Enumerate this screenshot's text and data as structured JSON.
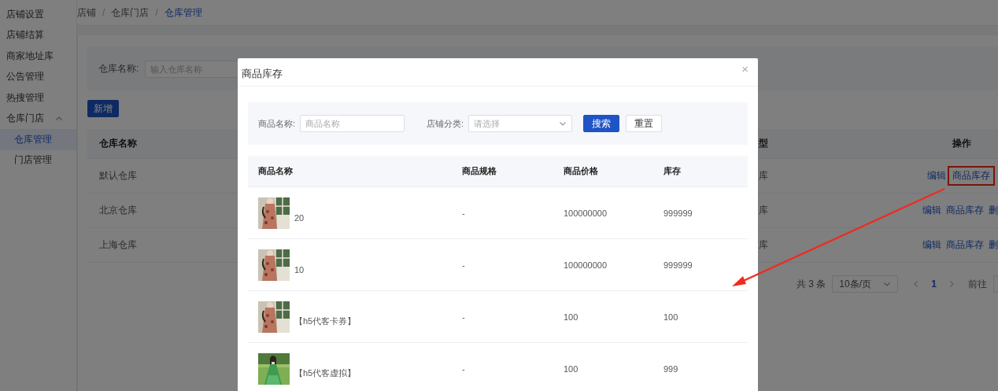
{
  "sidebar": {
    "items": [
      {
        "label": "店铺设置",
        "selected": false
      },
      {
        "label": "店铺结算",
        "selected": false
      },
      {
        "label": "商家地址库",
        "selected": false
      },
      {
        "label": "公告管理",
        "selected": false
      },
      {
        "label": "热搜管理",
        "selected": false
      },
      {
        "label": "仓库门店",
        "selected": false,
        "expanded": true,
        "children": [
          {
            "label": "仓库管理",
            "selected": true
          },
          {
            "label": "门店管理",
            "selected": false
          }
        ]
      }
    ]
  },
  "breadcrumb": {
    "separator": "/",
    "items": [
      "店铺",
      "仓库门店",
      "仓库管理"
    ]
  },
  "filter": {
    "label": "仓库名称:",
    "placeholder": "输入仓库名称"
  },
  "add_button": "新增",
  "table": {
    "columns": [
      "仓库名称",
      "型",
      "操作"
    ],
    "rows": [
      {
        "cells": [
          "默认仓库",
          "库"
        ],
        "actions": [
          {
            "label": "编辑",
            "highlighted": false
          },
          {
            "label": "商品库存",
            "highlighted": true
          }
        ]
      },
      {
        "cells": [
          "北京仓库",
          "库"
        ],
        "actions": [
          {
            "label": "编辑",
            "highlighted": false
          },
          {
            "label": "商品库存",
            "highlighted": false
          },
          {
            "label": "删",
            "highlighted": false
          }
        ]
      },
      {
        "cells": [
          "上海仓库",
          "库"
        ],
        "actions": [
          {
            "label": "编辑",
            "highlighted": false
          },
          {
            "label": "商品库存",
            "highlighted": false
          },
          {
            "label": "删",
            "highlighted": false
          }
        ]
      }
    ]
  },
  "pagination": {
    "total": "共 3 条",
    "page_size": "10条/页",
    "pages": [
      {
        "label": "1",
        "selected": true
      }
    ],
    "goto": "前往"
  },
  "modal": {
    "title": "商品库存",
    "close": "×",
    "filters": [
      {
        "kind": "input",
        "label": "商品名称:",
        "placeholder": "商品名称"
      },
      {
        "kind": "select",
        "label": "店铺分类:",
        "placeholder": "请选择"
      }
    ],
    "buttons": [
      {
        "kind": "primary",
        "label": "搜索"
      },
      {
        "kind": "default",
        "label": "重置"
      }
    ],
    "table": {
      "columns": [
        "商品名称",
        "商品规格",
        "商品价格",
        "库存"
      ],
      "rows": [
        {
          "name": "20",
          "spec": "-",
          "price": "100000000",
          "stock": "999999"
        },
        {
          "name": "10",
          "spec": "-",
          "price": "100000000",
          "stock": "999999"
        },
        {
          "name": "【h5代客卡券】",
          "spec": "-",
          "price": "100",
          "stock": "100"
        },
        {
          "name": "【h5代客虚拟】",
          "spec": "-",
          "price": "100",
          "stock": "999"
        }
      ]
    }
  }
}
